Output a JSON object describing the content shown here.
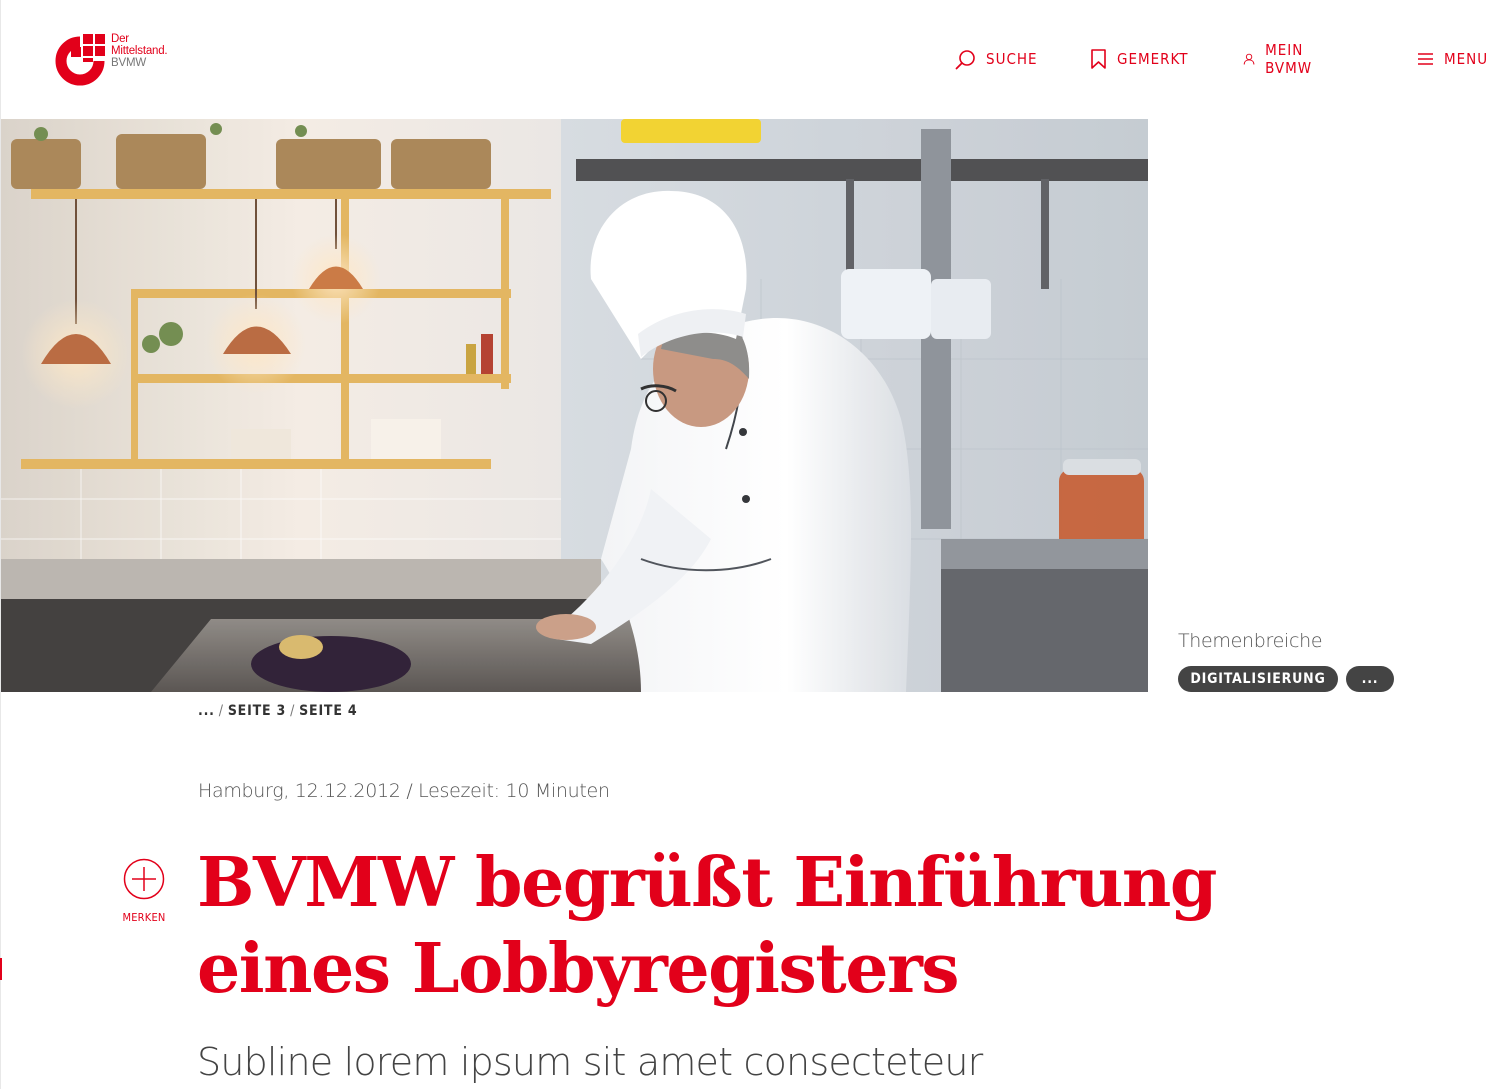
{
  "logo": {
    "line1": "Der",
    "line2": "Mittelstand.",
    "line3": "BVMW"
  },
  "nav": {
    "search": "SUCHE",
    "saved": "GEMERKT",
    "account": "MEIN BVMW",
    "menu": "MENU"
  },
  "topics": {
    "label": "Themenbreiche",
    "chips": [
      "DIGITALISIERUNG",
      "..."
    ]
  },
  "breadcrumb": {
    "ellipsis": "...",
    "separator": "/",
    "items": [
      "SEITE 3",
      "SEITE 4"
    ]
  },
  "article": {
    "meta": "Hamburg, 12.12.2012 / Lesezeit: 10 Minuten",
    "bookmark_label": "MERKEN",
    "headline_line1": "BVMW begrüßt Einführung",
    "headline_line2": "eines Lobbyregisters",
    "subline": "Subline lorem ipsum sit amet consecteteur"
  },
  "colors": {
    "brand_red": "#e2001a",
    "chip_bg": "#444444",
    "text_gray": "#555555"
  }
}
